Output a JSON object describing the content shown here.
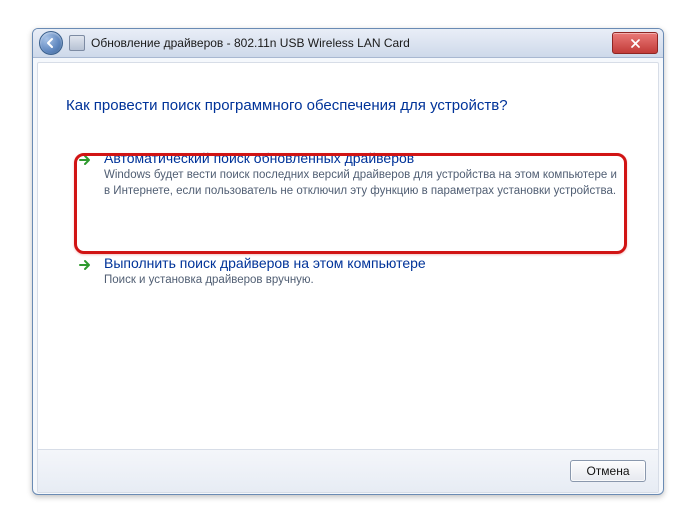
{
  "window": {
    "title": "Обновление драйверов - 802.11n USB Wireless LAN Card"
  },
  "heading": "Как провести поиск программного обеспечения для устройств?",
  "options": [
    {
      "title": "Автоматический поиск обновленных драйверов",
      "desc": "Windows будет вести поиск последних версий драйверов для устройства на этом компьютере и в Интернете, если пользователь не отключил эту функцию в параметрах установки устройства."
    },
    {
      "title": "Выполнить поиск драйверов на этом компьютере",
      "desc": "Поиск и установка драйверов вручную."
    }
  ],
  "buttons": {
    "cancel": "Отмена"
  }
}
